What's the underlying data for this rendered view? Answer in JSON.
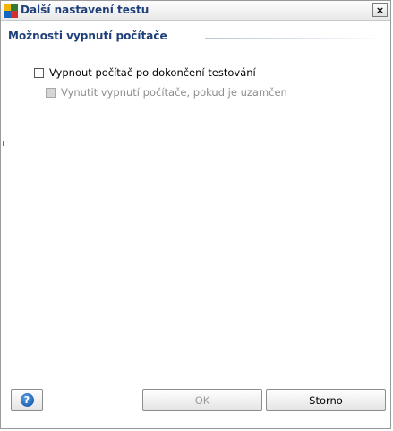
{
  "window": {
    "title": "Další nastavení testu",
    "close_label": "×"
  },
  "section": {
    "title": "Možnosti vypnutí počítače"
  },
  "options": [
    {
      "label": "Vypnout počítač po dokončení testování",
      "checked": false,
      "enabled": true
    },
    {
      "label": "Vynutit vypnutí počítače, pokud je uzamčen",
      "checked": false,
      "enabled": false
    }
  ],
  "footer": {
    "help_icon": "help-question-icon",
    "help_symbol": "?",
    "ok_label": "OK",
    "ok_enabled": false,
    "cancel_label": "Storno"
  },
  "colors": {
    "title_text": "#1f3f7a",
    "disabled_text": "#8d8d8d"
  }
}
